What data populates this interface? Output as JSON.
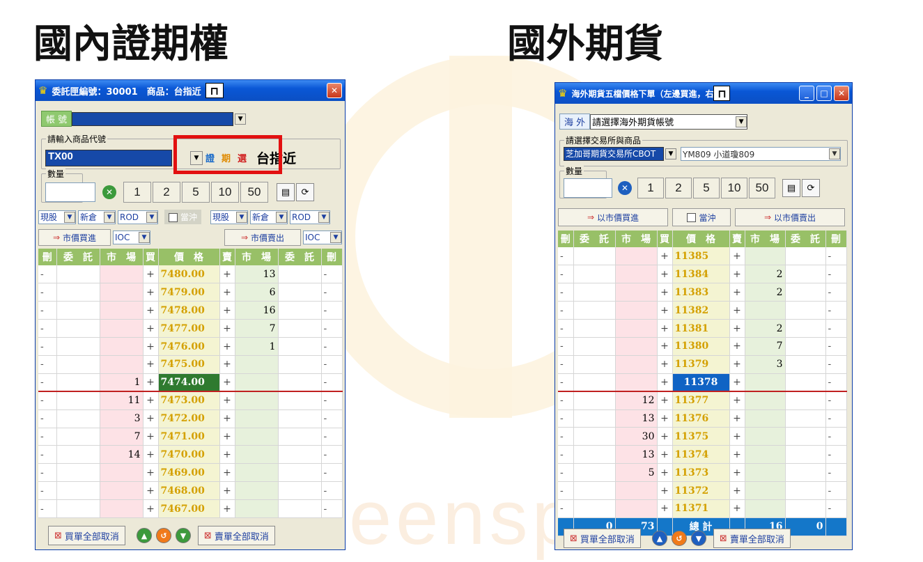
{
  "titles": {
    "left": "國內證期權",
    "right": "國外期貨"
  },
  "background": {
    "text": "keensp"
  },
  "left": {
    "title": "委託匣編號：30001　商品：台指近",
    "account_label": "帳 號",
    "product_group": "請輸入商品代號",
    "product_code": "TX00",
    "tabs": [
      "證",
      "期",
      "選"
    ],
    "product_name": "台指近",
    "qty_group": "數量",
    "qty_buttons": [
      "1",
      "2",
      "5",
      "10",
      "50"
    ],
    "buy_opts": [
      "現股",
      "新倉",
      "ROD"
    ],
    "sell_opts": [
      "現股",
      "新倉",
      "ROD"
    ],
    "daytrade": "當沖",
    "buy_market": "市價買進",
    "sell_market": "市價賣出",
    "buy_ioc": "IOC",
    "sell_ioc": "IOC",
    "headers": [
      "刪",
      "委　託",
      "市　場",
      "買",
      "價　格",
      "賣",
      "市　場",
      "委　託",
      "刪"
    ],
    "rows": [
      {
        "price": "7480.00",
        "buy": "",
        "sell": "13"
      },
      {
        "price": "7479.00",
        "buy": "",
        "sell": "6"
      },
      {
        "price": "7478.00",
        "buy": "",
        "sell": "16"
      },
      {
        "price": "7477.00",
        "buy": "",
        "sell": "7"
      },
      {
        "price": "7476.00",
        "buy": "",
        "sell": "1"
      },
      {
        "price": "7475.00",
        "buy": "",
        "sell": ""
      },
      {
        "price": "7474.00",
        "buy": "1",
        "sell": ""
      },
      {
        "price": "7473.00",
        "buy": "11",
        "sell": ""
      },
      {
        "price": "7472.00",
        "buy": "3",
        "sell": ""
      },
      {
        "price": "7471.00",
        "buy": "7",
        "sell": ""
      },
      {
        "price": "7470.00",
        "buy": "14",
        "sell": ""
      },
      {
        "price": "7469.00",
        "buy": "",
        "sell": ""
      },
      {
        "price": "7468.00",
        "buy": "",
        "sell": ""
      },
      {
        "price": "7467.00",
        "buy": "",
        "sell": ""
      }
    ],
    "current_index": 6,
    "cancel_buy": "買單全部取消",
    "cancel_sell": "賣單全部取消"
  },
  "right": {
    "title": "海外期貨五檔價格下單（左邊買進，右",
    "account_label": "海 外",
    "account_value": "請選擇海外期貨帳號",
    "exch_group": "請選擇交易所與商品",
    "exchange": "芝加哥期貨交易所CBOT",
    "product": "YM809 小道瓊809",
    "qty_group": "數量",
    "qty_buttons": [
      "1",
      "2",
      "5",
      "10",
      "50"
    ],
    "buy_market": "以市價買進",
    "daytrade": "當沖",
    "sell_market": "以市價賣出",
    "headers": [
      "刪",
      "委　託",
      "市　場",
      "買",
      "價　格",
      "賣",
      "市　場",
      "委　託",
      "刪"
    ],
    "rows": [
      {
        "price": "11385",
        "buy": "",
        "sell": ""
      },
      {
        "price": "11384",
        "buy": "",
        "sell": "2"
      },
      {
        "price": "11383",
        "buy": "",
        "sell": "2"
      },
      {
        "price": "11382",
        "buy": "",
        "sell": ""
      },
      {
        "price": "11381",
        "buy": "",
        "sell": "2"
      },
      {
        "price": "11380",
        "buy": "",
        "sell": "7"
      },
      {
        "price": "11379",
        "buy": "",
        "sell": "3"
      },
      {
        "price": "11378",
        "buy": "",
        "sell": ""
      },
      {
        "price": "11377",
        "buy": "12",
        "sell": ""
      },
      {
        "price": "11376",
        "buy": "13",
        "sell": ""
      },
      {
        "price": "11375",
        "buy": "30",
        "sell": ""
      },
      {
        "price": "11374",
        "buy": "13",
        "sell": ""
      },
      {
        "price": "11373",
        "buy": "5",
        "sell": ""
      },
      {
        "price": "11372",
        "buy": "",
        "sell": ""
      },
      {
        "price": "11371",
        "buy": "",
        "sell": ""
      }
    ],
    "current_index": 7,
    "totals": {
      "buy_order": "0",
      "buy_market": "73",
      "label": "總 計",
      "sell_market": "16",
      "sell_order": "0"
    },
    "cancel_buy": "買單全部取消",
    "cancel_sell": "賣單全部取消"
  }
}
